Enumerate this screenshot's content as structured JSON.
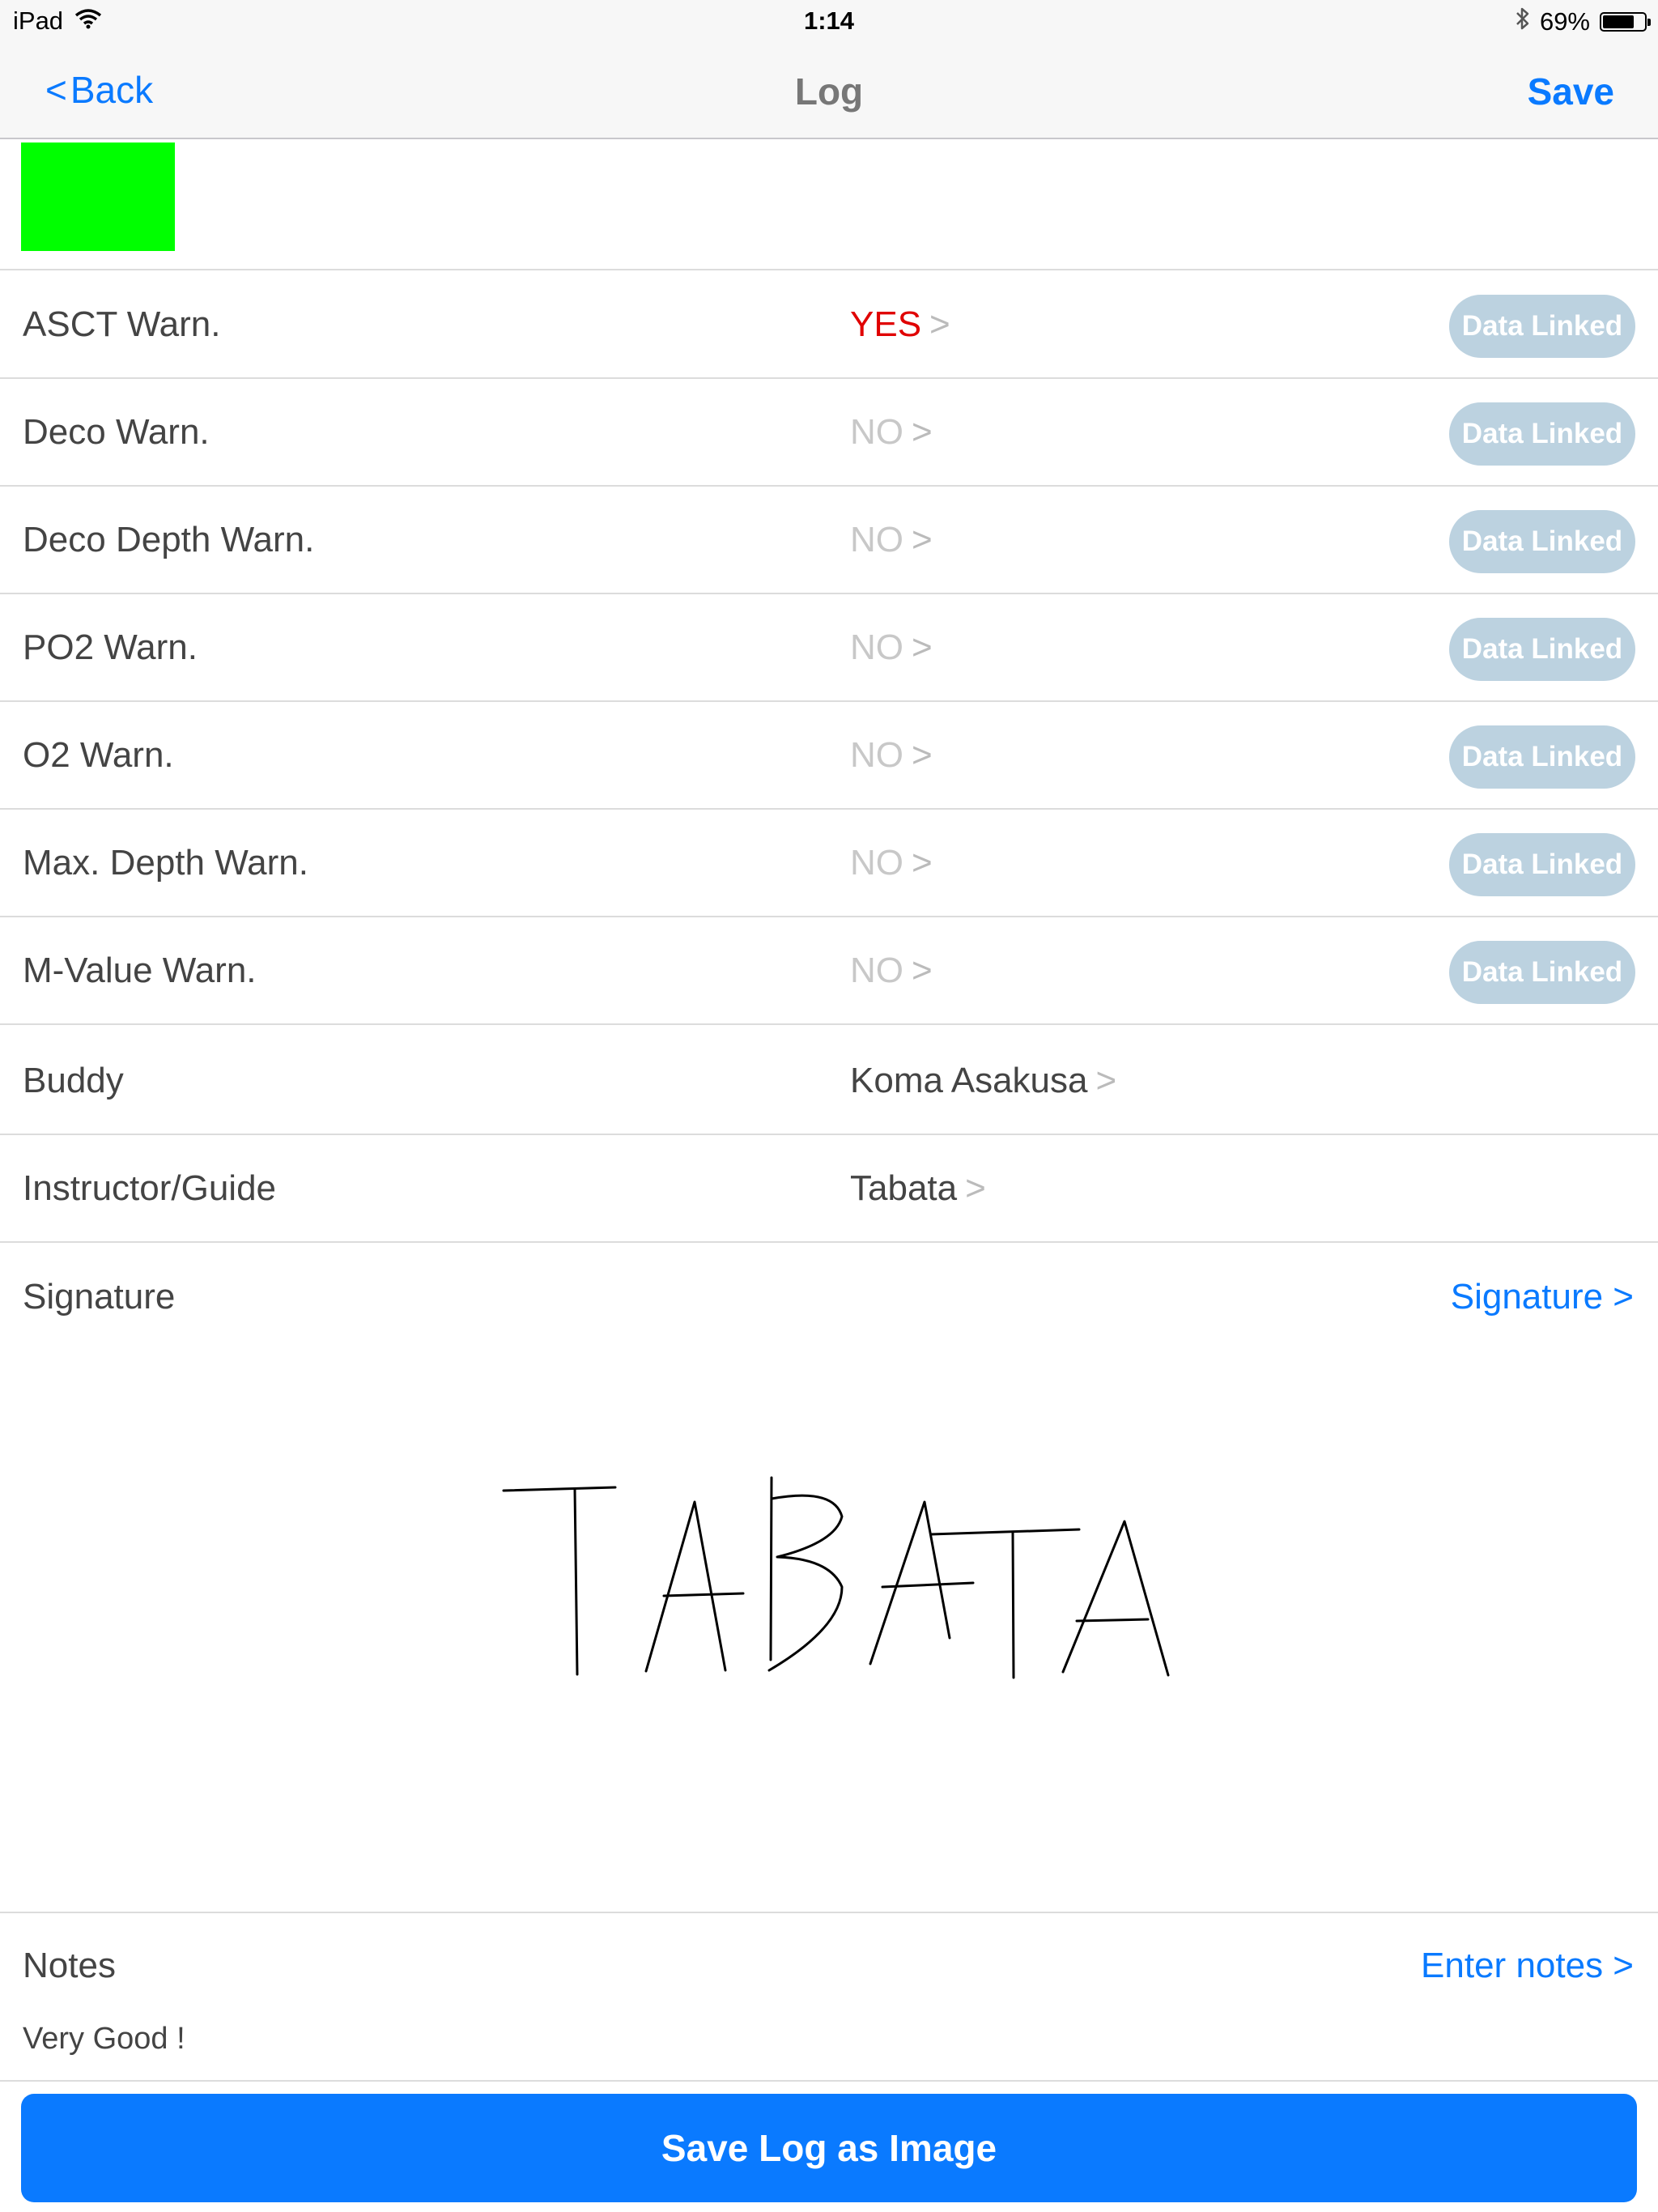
{
  "status_bar": {
    "device": "iPad",
    "time": "1:14",
    "battery": "69%",
    "battery_level": 0.69
  },
  "nav": {
    "back_label": "Back",
    "back_chevron": "<",
    "title": "Log",
    "save_label": "Save"
  },
  "color_swatch": {
    "color": "#00ff00"
  },
  "rows": [
    {
      "label": "ASCT Warn.",
      "value": "YES",
      "badge": "Data Linked"
    },
    {
      "label": "Deco Warn.",
      "value": "NO",
      "badge": "Data Linked"
    },
    {
      "label": "Deco Depth Warn.",
      "value": "NO",
      "badge": "Data Linked"
    },
    {
      "label": "PO2 Warn.",
      "value": "NO",
      "badge": "Data Linked"
    },
    {
      "label": "O2 Warn.",
      "value": "NO",
      "badge": "Data Linked"
    },
    {
      "label": "Max. Depth Warn.",
      "value": "NO",
      "badge": "Data Linked"
    },
    {
      "label": "M-Value Warn.",
      "value": "NO",
      "badge": "Data Linked"
    },
    {
      "label": "Buddy",
      "value": "Koma Asakusa"
    },
    {
      "label": "Instructor/Guide",
      "value": "Tabata"
    }
  ],
  "chevron": ">",
  "signature": {
    "label": "Signature",
    "link": "Signature >",
    "handwritten": "TABATA"
  },
  "notes": {
    "label": "Notes",
    "link": "Enter notes >",
    "text": "Very Good !"
  },
  "save_image_button": "Save Log as Image",
  "colors": {
    "accent": "#0a7aff",
    "warning": "#e00000",
    "badge_bg": "#bcd2e0"
  }
}
